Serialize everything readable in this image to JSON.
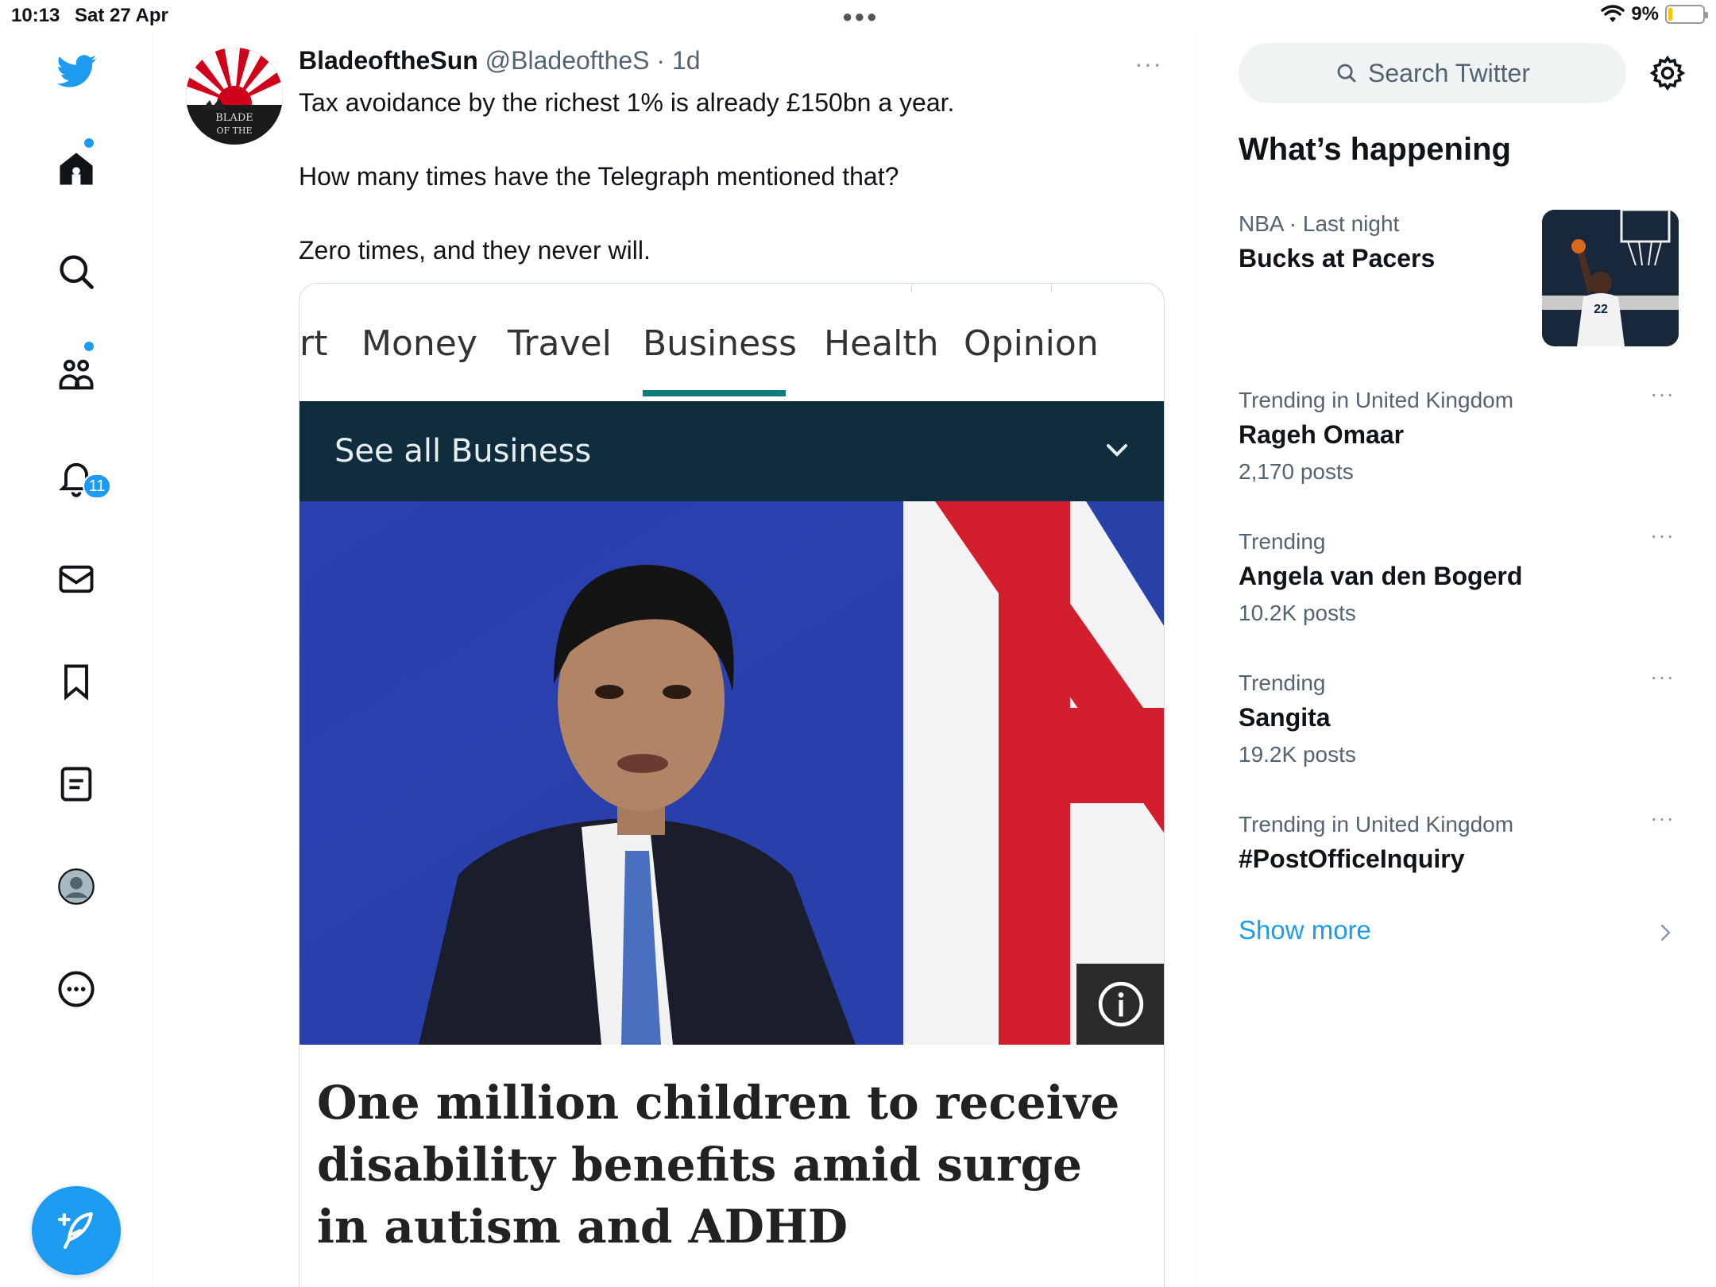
{
  "status_bar": {
    "time": "10:13",
    "date": "Sat 27 Apr",
    "battery": "9%",
    "battery_level": 0.09
  },
  "nav": {
    "icons": [
      "twitter-logo-icon",
      "home-icon",
      "search-icon",
      "communities-icon",
      "notifications-icon",
      "messages-icon",
      "bookmarks-icon",
      "lists-icon",
      "profile-icon",
      "more-icon"
    ],
    "notification_count": "11",
    "compose_icon": "compose-tweet-icon"
  },
  "tweet": {
    "display_name": "BladeoftheSun",
    "handle": "@BladeoftheS",
    "time": "· 1d",
    "more": "···",
    "text_lines": [
      "Tax avoidance by the richest 1% is already £150bn a year.",
      "How many times have the Telegraph mentioned that?",
      "Zero times, and they never will."
    ],
    "media": {
      "nav_tabs": [
        "rt",
        "Money",
        "Travel",
        "Business",
        "Health",
        "Opinion"
      ],
      "active_tab": "Business",
      "bar_label": "See all Business",
      "headline": "One million children to receive disability benefits amid surge in autism and ADHD"
    }
  },
  "sidebar": {
    "search_placeholder": "Search Twitter",
    "title": "What’s happening",
    "trends": [
      {
        "meta": "NBA · Last night",
        "title": "Bucks at Pacers",
        "posts": ""
      },
      {
        "meta": "Trending in United Kingdom",
        "title": "Rageh Omaar",
        "posts": "2,170 posts"
      },
      {
        "meta": "Trending",
        "title": "Angela van den Bogerd",
        "posts": "10.2K posts"
      },
      {
        "meta": "Trending",
        "title": "Sangita",
        "posts": "19.2K posts"
      },
      {
        "meta": "Trending in United Kingdom",
        "title": "#PostOfficeInquiry",
        "posts": ""
      }
    ],
    "more_glyph": "···",
    "show_more": "Show more"
  },
  "colors": {
    "twitter_blue": "#1d9bf0",
    "telegraph_bar": "#0f2d3d",
    "telegraph_accent": "#0f7c7c"
  }
}
